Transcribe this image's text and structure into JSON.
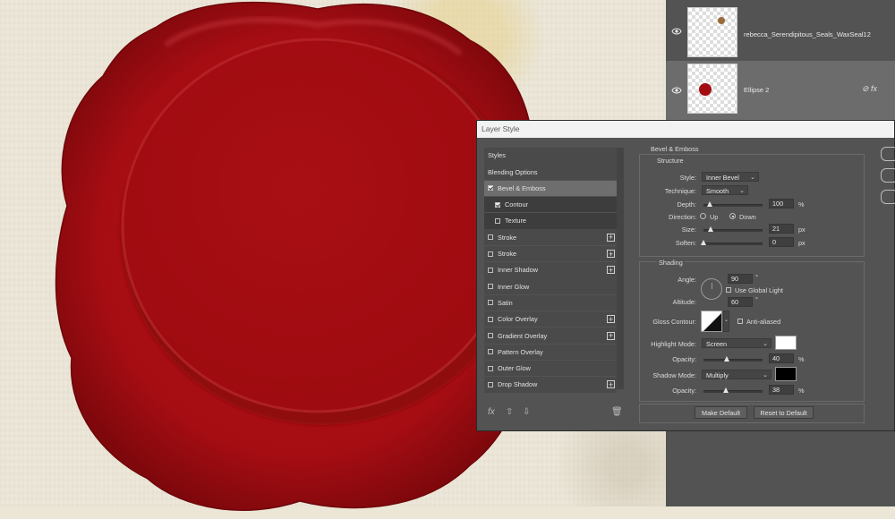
{
  "layers_panel": {
    "rows": [
      {
        "name": "rebecca_Serendipitous_Seals_WaxSeal12",
        "selected": false
      },
      {
        "name": "Ellipse 2",
        "selected": true
      }
    ]
  },
  "dialog": {
    "title": "Layer Style",
    "style_list": [
      {
        "label": "Styles",
        "checkbox": false,
        "checked": false,
        "plus": false,
        "state": "head"
      },
      {
        "label": "Blending Options",
        "checkbox": false,
        "checked": false,
        "plus": false,
        "state": "head"
      },
      {
        "label": "Bevel & Emboss",
        "checkbox": true,
        "checked": true,
        "plus": false,
        "state": "active"
      },
      {
        "label": "Contour",
        "checkbox": true,
        "checked": true,
        "plus": false,
        "state": "sub"
      },
      {
        "label": "Texture",
        "checkbox": true,
        "checked": false,
        "plus": false,
        "state": "sub"
      },
      {
        "label": "Stroke",
        "checkbox": true,
        "checked": false,
        "plus": true,
        "state": ""
      },
      {
        "label": "Stroke",
        "checkbox": true,
        "checked": false,
        "plus": true,
        "state": ""
      },
      {
        "label": "Inner Shadow",
        "checkbox": true,
        "checked": false,
        "plus": true,
        "state": ""
      },
      {
        "label": "Inner Glow",
        "checkbox": true,
        "checked": false,
        "plus": false,
        "state": ""
      },
      {
        "label": "Satin",
        "checkbox": true,
        "checked": false,
        "plus": false,
        "state": ""
      },
      {
        "label": "Color Overlay",
        "checkbox": true,
        "checked": false,
        "plus": true,
        "state": ""
      },
      {
        "label": "Gradient Overlay",
        "checkbox": true,
        "checked": false,
        "plus": true,
        "state": ""
      },
      {
        "label": "Pattern Overlay",
        "checkbox": true,
        "checked": false,
        "plus": false,
        "state": ""
      },
      {
        "label": "Outer Glow",
        "checkbox": true,
        "checked": false,
        "plus": false,
        "state": ""
      },
      {
        "label": "Drop Shadow",
        "checkbox": true,
        "checked": false,
        "plus": true,
        "state": ""
      }
    ],
    "bottom_icons": {
      "fx": "fx",
      "up": "up-arrow-icon",
      "down": "down-arrow-icon",
      "trash": "trash-icon"
    },
    "section_title": "Bevel & Emboss",
    "structure": {
      "title": "Structure",
      "style_label": "Style:",
      "style_value": "Inner Bevel",
      "technique_label": "Technique:",
      "technique_value": "Smooth",
      "depth_label": "Depth:",
      "depth_value": "100",
      "depth_unit": "%",
      "depth_fraction": 0.1,
      "direction_label": "Direction:",
      "direction_up": "Up",
      "direction_down": "Down",
      "direction_selected": "Down",
      "size_label": "Size:",
      "size_value": "21",
      "size_unit": "px",
      "size_fraction": 0.12,
      "soften_label": "Soften:",
      "soften_value": "0",
      "soften_unit": "px",
      "soften_fraction": 0
    },
    "shading": {
      "title": "Shading",
      "angle_label": "Angle:",
      "angle_value": "90",
      "degree_symbol": "°",
      "use_global_light": "Use Global Light",
      "altitude_label": "Altitude:",
      "altitude_value": "60",
      "gloss_contour_label": "Gloss Contour:",
      "anti_aliased": "Anti-aliased",
      "highlight_mode_label": "Highlight Mode:",
      "highlight_mode_value": "Screen",
      "highlight_color": "#ffffff",
      "highlight_opacity_label": "Opacity:",
      "highlight_opacity_value": "40",
      "highlight_opacity_fraction": 0.4,
      "shadow_mode_label": "Shadow Mode:",
      "shadow_mode_value": "Multiply",
      "shadow_color": "#000000",
      "shadow_opacity_label": "Opacity:",
      "shadow_opacity_value": "38",
      "shadow_opacity_fraction": 0.38,
      "percent": "%"
    },
    "buttons": {
      "make_default": "Make Default",
      "reset_default": "Reset to Default"
    }
  },
  "colors": {
    "wax": "#a30d12",
    "wax_dark": "#7a070b",
    "panel": "#535353",
    "dialog_title_bg": "#f2f2f2"
  }
}
